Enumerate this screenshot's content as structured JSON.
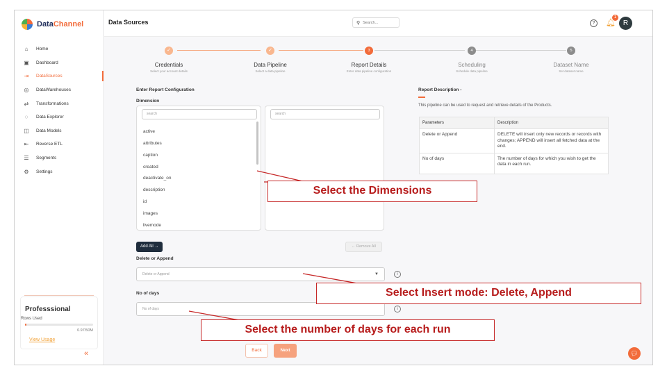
{
  "app": {
    "brand_part1": "Data",
    "brand_part2": "Channel",
    "page_title": "Data Sources",
    "colors": {
      "accent": "#f26b3a",
      "dark": "#1f2d3d",
      "callout": "#c62828"
    }
  },
  "sidebar": {
    "items": [
      {
        "label": "Home",
        "icon": "home-icon"
      },
      {
        "label": "Dashboard",
        "icon": "dashboard-icon"
      },
      {
        "label": "DataSources",
        "icon": "datasource-icon"
      },
      {
        "label": "DataWarehouses",
        "icon": "database-icon"
      },
      {
        "label": "Transformations",
        "icon": "transform-icon"
      },
      {
        "label": "Data Explorer",
        "icon": "explorer-icon"
      },
      {
        "label": "Data Models",
        "icon": "models-icon"
      },
      {
        "label": "Reverse ETL",
        "icon": "reverse-etl-icon"
      },
      {
        "label": "Segments",
        "icon": "segments-icon"
      },
      {
        "label": "Settings",
        "icon": "settings-icon"
      }
    ],
    "active_index": 2,
    "plan": {
      "title": "Professsional",
      "rows_label": "Rows Used",
      "usage": "0.97/50M",
      "usage_fraction": 0.02,
      "link": "View Usage"
    }
  },
  "header": {
    "search_placeholder": "Search...",
    "help": "?",
    "notification_count": "1",
    "avatar_initial": "R"
  },
  "stepper": [
    {
      "title": "Credentials",
      "sub": "Select your account details",
      "state": "done",
      "mark": "✓"
    },
    {
      "title": "Data Pipeline",
      "sub": "Select a data pipeline",
      "state": "done",
      "mark": "✓"
    },
    {
      "title": "Report Details",
      "sub": "Enter data pipeline configuration",
      "state": "current",
      "mark": "3"
    },
    {
      "title": "Scheduling",
      "sub": "Schedule data pipeline",
      "state": "todo",
      "mark": "4"
    },
    {
      "title": "Dataset Name",
      "sub": "Set dataset name",
      "state": "todo",
      "mark": "5"
    }
  ],
  "form": {
    "section_title": "Enter Report Configuration",
    "dimension_label": "Dimension",
    "left_search_placeholder": "search",
    "right_search_placeholder": "search",
    "dimensions": [
      "active",
      "attributes",
      "caption",
      "created",
      "deactivate_on",
      "description",
      "id",
      "images",
      "livemode"
    ],
    "add_all": "Add All →",
    "remove_all": "← Remove All",
    "delete_append_label": "Delete or Append",
    "delete_append_placeholder": "Delete or Append",
    "no_days_label": "No of days",
    "no_days_placeholder": "No of days",
    "back": "Back",
    "next": "Next"
  },
  "report_description": {
    "title": "Report Description -",
    "text": "This pipeline can be used to request and retrieve details of the Products.",
    "headers": [
      "Parameters",
      "Description"
    ],
    "rows": [
      [
        "Delete or Append",
        "DELETE will insert only new records or records with changes; APPEND will insert all fetched data at the end."
      ],
      [
        "No of days",
        "The number of days for which you wish to get the data in each run."
      ]
    ]
  },
  "callouts": {
    "dimensions": "Select the Dimensions",
    "insert_mode": "Select Insert mode: Delete, Append",
    "days": "Select the number of days for each run"
  }
}
